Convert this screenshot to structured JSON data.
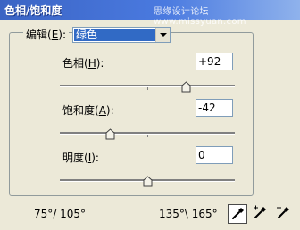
{
  "window": {
    "title": "色相/饱和度",
    "watermark": "思缘设计论坛 www.missyuan.com"
  },
  "edit": {
    "label_prefix": "编辑(",
    "label_key": "E",
    "label_suffix": "):",
    "selected": "绿色"
  },
  "sliders": {
    "hue": {
      "label_prefix": "色相(",
      "key": "H",
      "label_suffix": "):",
      "value": "+92",
      "level_fraction": 0.72
    },
    "saturation": {
      "label_prefix": "饱和度(",
      "key": "A",
      "label_suffix": "):",
      "value": "-42",
      "level_fraction": 0.29
    },
    "lightness": {
      "label_prefix": "明度(",
      "key": "I",
      "label_suffix": "):",
      "value": "0",
      "level_fraction": 0.5
    }
  },
  "range": {
    "left": "75°/ 105°",
    "right": "135°\\ 165°"
  },
  "tools": {
    "eyedropper": "eyedropper-icon",
    "add": "eyedropper-plus-icon",
    "subtract": "eyedropper-minus-icon"
  }
}
